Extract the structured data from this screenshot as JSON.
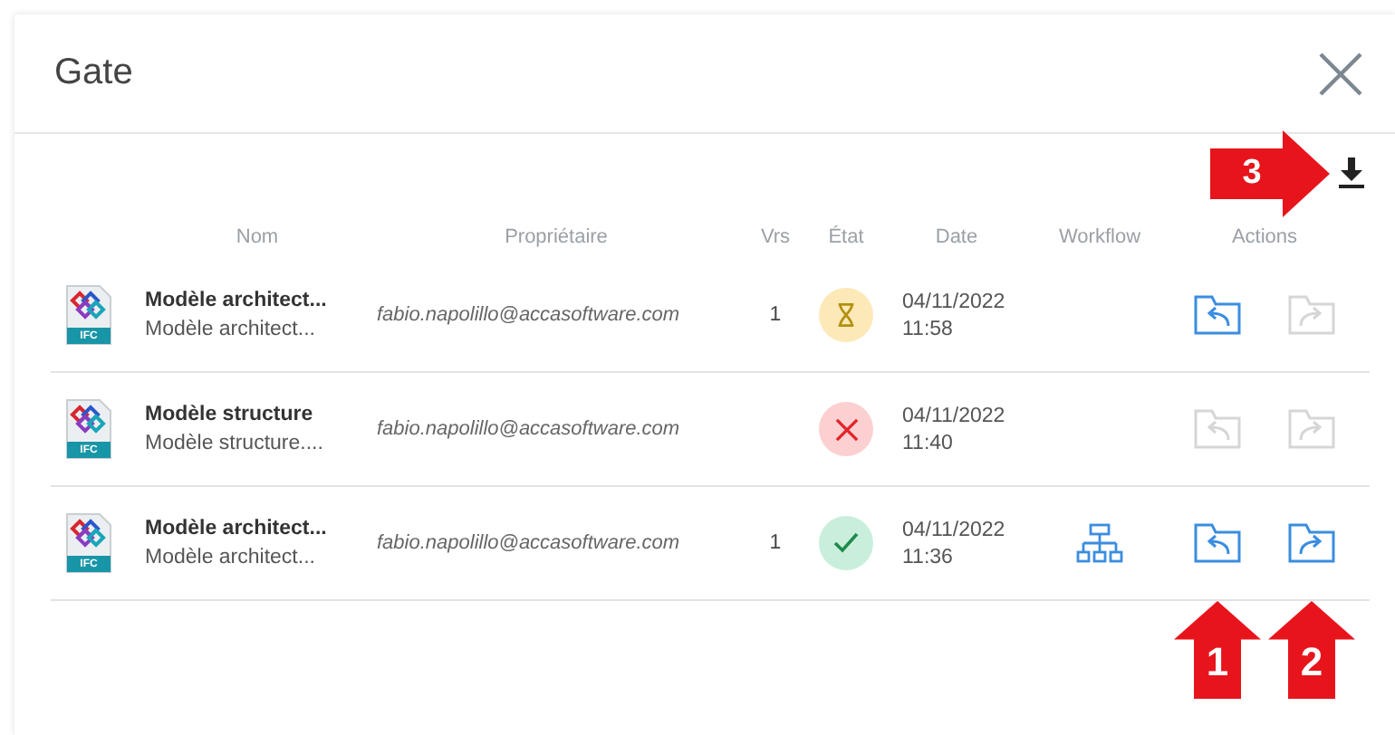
{
  "dialog": {
    "title": "Gate"
  },
  "toolbar": {
    "callout": {
      "label": "3",
      "kind": "right"
    }
  },
  "table": {
    "columns": [
      "Nom",
      "Propriétaire",
      "Vrs",
      "État",
      "Date",
      "Workflow",
      "Actions"
    ],
    "rows": [
      {
        "file_type": "IFC",
        "name": "Modèle architect...",
        "description": "Modèle architect...",
        "owner": "fabio.napolillo@accasoftware.com",
        "version": "1",
        "kind": "pending",
        "date": "04/11/2022",
        "time": "11:58",
        "workflow": false,
        "actions": [
          {
            "kind": "import",
            "enabled": true
          },
          {
            "kind": "export",
            "enabled": false
          }
        ]
      },
      {
        "file_type": "IFC",
        "name": "Modèle structure",
        "description": "Modèle structure....",
        "owner": "fabio.napolillo@accasoftware.com",
        "kind": "rejected",
        "date": "04/11/2022",
        "time": "11:40",
        "workflow": false,
        "actions": [
          {
            "kind": "import",
            "enabled": false
          },
          {
            "kind": "export",
            "enabled": false
          }
        ]
      },
      {
        "file_type": "IFC",
        "name": "Modèle architect...",
        "description": "Modèle architect...",
        "owner": "fabio.napolillo@accasoftware.com",
        "version": "1",
        "kind": "approved",
        "date": "04/11/2022",
        "time": "11:36",
        "workflow": true,
        "actions": [
          {
            "kind": "import",
            "enabled": true
          },
          {
            "kind": "export",
            "enabled": true
          }
        ]
      }
    ]
  },
  "callouts": [
    {
      "label": "1",
      "kind": "up"
    },
    {
      "label": "2",
      "kind": "up"
    }
  ]
}
